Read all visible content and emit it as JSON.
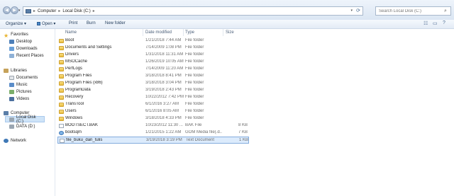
{
  "address": {
    "crumbs": [
      "Computer",
      "Local Disk (C:)"
    ],
    "separator": "▸"
  },
  "search": {
    "placeholder": "Search Local Disk (C:)"
  },
  "toolbar": {
    "organize": "Organize ▾",
    "open": "Open ▾",
    "print": "Print",
    "burn": "Burn",
    "new_folder": "New folder"
  },
  "nav": {
    "favorites": "Favorites",
    "desktop": "Desktop",
    "downloads": "Downloads",
    "recent": "Recent Places",
    "libraries": "Libraries",
    "documents": "Documents",
    "music": "Music",
    "pictures": "Pictures",
    "videos": "Videos",
    "computer": "Computer",
    "local_disk": "Local Disk (C:)",
    "data": "DATA (D:)",
    "network": "Network"
  },
  "columns": {
    "name": "Name",
    "date": "Date modified",
    "type": "Type",
    "size": "Size"
  },
  "files": [
    {
      "name": "Boot",
      "date": "1/21/2018 7:44 AM",
      "type": "File folder",
      "size": "",
      "icon": "folder-icon"
    },
    {
      "name": "Documents and Settings",
      "date": "7/14/2009 1:08 PM",
      "type": "File folder",
      "size": "",
      "icon": "folder-icon"
    },
    {
      "name": "Drivers",
      "date": "1/31/2018 11:31 AM",
      "type": "File folder",
      "size": "",
      "icon": "folder-icon"
    },
    {
      "name": "MSOCache",
      "date": "1/26/2019 10:05 AM",
      "type": "File folder",
      "size": "",
      "icon": "folder-icon"
    },
    {
      "name": "PerfLogs",
      "date": "7/14/2009 11:20 AM",
      "type": "File folder",
      "size": "",
      "icon": "folder-icon"
    },
    {
      "name": "Program Files",
      "date": "3/18/2018 8:41 PM",
      "type": "File folder",
      "size": "",
      "icon": "folder-icon"
    },
    {
      "name": "Program Files (x86)",
      "date": "3/18/2018 3:04 PM",
      "type": "File folder",
      "size": "",
      "icon": "folder-icon"
    },
    {
      "name": "ProgramData",
      "date": "3/19/2018 2:43 PM",
      "type": "File folder",
      "size": "",
      "icon": "folder-icon"
    },
    {
      "name": "Recovery",
      "date": "10/22/2012 7:42 PM",
      "type": "File folder",
      "size": "",
      "icon": "folder-icon"
    },
    {
      "name": "TransTool",
      "date": "6/1/2016 3:27 AM",
      "type": "File folder",
      "size": "",
      "icon": "folder-icon"
    },
    {
      "name": "Users",
      "date": "6/1/2016 8:05 AM",
      "type": "File folder",
      "size": "",
      "icon": "folder-icon"
    },
    {
      "name": "Windows",
      "date": "3/18/2018 4:33 PM",
      "type": "File folder",
      "size": "",
      "icon": "folder-icon"
    },
    {
      "name": "BOOTSECT.BAK",
      "date": "10/23/2012 11:30 ...",
      "type": "BAK File",
      "size": "8 KB",
      "icon": "file-icon"
    },
    {
      "name": "bootsqm",
      "date": "1/21/2015 1:22 AM",
      "type": "GOM Media file(.d...",
      "size": "7 KB",
      "icon": "media-file-icon"
    },
    {
      "name": "file_buku_dan_tulis",
      "date": "3/19/2018 3:19 PM",
      "type": "Text Document",
      "size": "1 KB",
      "icon": "text-file-icon"
    }
  ],
  "selected_row": 14,
  "colors": {
    "selection": "#dcebfc",
    "folder": "#e9bd3d"
  }
}
